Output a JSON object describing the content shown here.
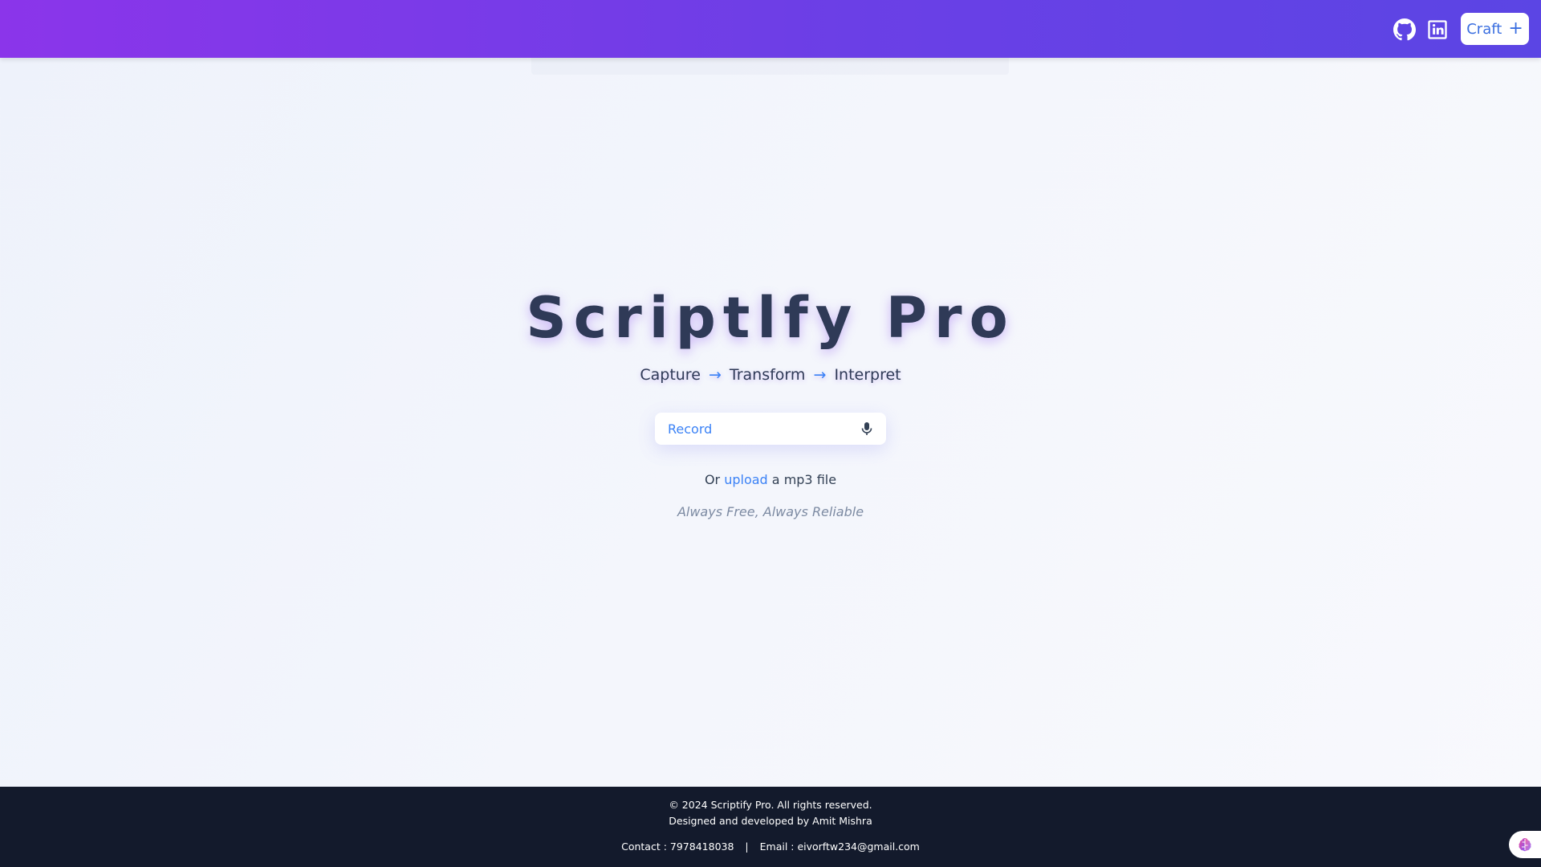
{
  "header": {
    "icons": {
      "github": "github-icon",
      "linkedin": "linkedin-icon"
    },
    "craft_button": {
      "label": "Craft",
      "icon": "plus-icon"
    },
    "gradient": [
      "#8b35ea",
      "#5b45e4"
    ]
  },
  "hero": {
    "title": "Scriptlfy Pro",
    "tagline": {
      "step1": "Capture",
      "arrow": "→",
      "step2": "Transform",
      "step3": "Interpret"
    },
    "record": {
      "label": "Record",
      "icon": "microphone-icon"
    },
    "upload": {
      "prefix": "Or",
      "link": "upload",
      "suffix": "a mp3 file"
    },
    "promise": "Always Free, Always Reliable"
  },
  "footer": {
    "copyright": "© 2024 Scriptify Pro. All rights reserved.",
    "credit": "Designed and developed by Amit Mishra",
    "contact": "Contact : 7978418038",
    "separator": "|",
    "email": "Email : eivorftw234@gmail.com"
  },
  "floating_button": {
    "icon": "brain-icon"
  },
  "colors": {
    "accent": "#3b82f6",
    "title": "#2f3a57",
    "footer_bg": "#131a2c"
  }
}
